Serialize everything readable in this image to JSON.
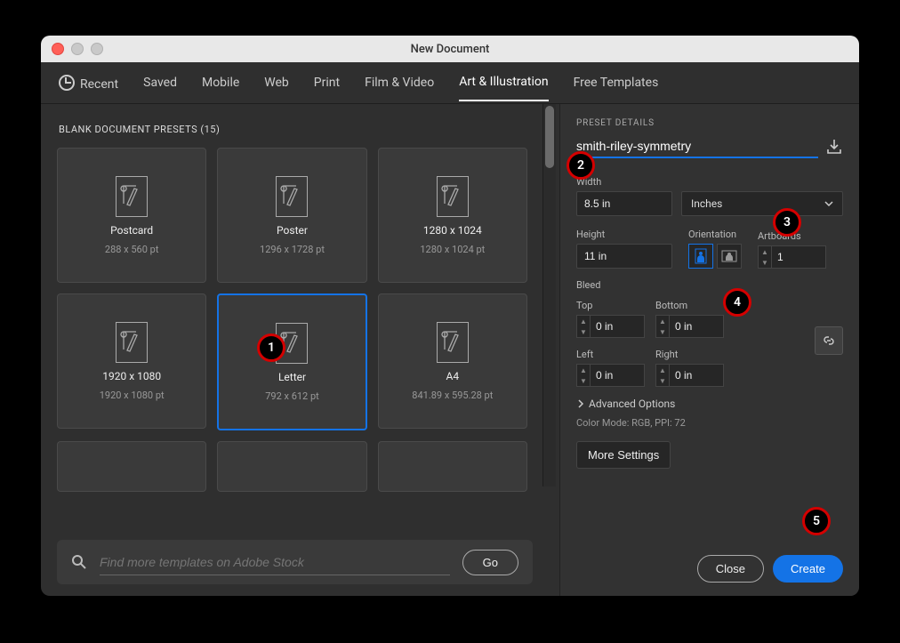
{
  "window": {
    "title": "New Document"
  },
  "tabs": [
    "Recent",
    "Saved",
    "Mobile",
    "Web",
    "Print",
    "Film & Video",
    "Art & Illustration",
    "Free Templates"
  ],
  "active_tab": "Art & Illustration",
  "presets_header": "BLANK DOCUMENT PRESETS  (15)",
  "cards": [
    {
      "name": "Postcard",
      "dim": "288 x 560 pt"
    },
    {
      "name": "Poster",
      "dim": "1296 x 1728 pt"
    },
    {
      "name": "1280 x 1024",
      "dim": "1280 x 1024 pt"
    },
    {
      "name": "1920 x 1080",
      "dim": "1920 x 1080 pt"
    },
    {
      "name": "Letter",
      "dim": "792 x 612 pt",
      "selected": true
    },
    {
      "name": "A4",
      "dim": "841.89 x 595.28 pt"
    }
  ],
  "search": {
    "placeholder": "Find more templates on Adobe Stock",
    "go": "Go"
  },
  "details": {
    "title": "PRESET DETAILS",
    "doc_name": "smith-riley-symmetry",
    "width_label": "Width",
    "width_value": "8.5 in",
    "unit": "Inches",
    "height_label": "Height",
    "height_value": "11 in",
    "orientation_label": "Orientation",
    "artboards_label": "Artboards",
    "artboards_value": "1",
    "bleed_label": "Bleed",
    "top_label": "Top",
    "bottom_label": "Bottom",
    "left_label": "Left",
    "right_label": "Right",
    "bleed_value": "0 in",
    "advanced": "Advanced Options",
    "mode": "Color Mode:  RGB,  PPI:  72",
    "more": "More Settings",
    "close": "Close",
    "create": "Create"
  },
  "annotations": [
    1,
    2,
    3,
    4,
    5
  ]
}
